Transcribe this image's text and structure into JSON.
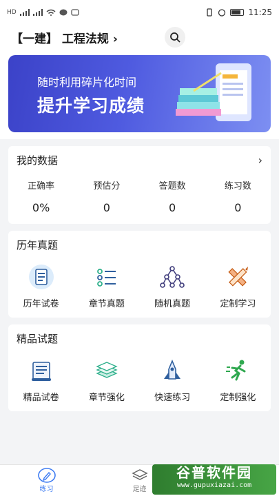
{
  "status_bar": {
    "left_label": "HD",
    "time": "11:25"
  },
  "header": {
    "title": "【一建】 工程法规",
    "chevron": "›"
  },
  "banner": {
    "line1": "随时利用碎片化时间",
    "line2": "提升学习成绩"
  },
  "my_data": {
    "title": "我的数据",
    "chevron": "›",
    "stats": [
      {
        "label": "正确率",
        "value": "0%"
      },
      {
        "label": "预估分",
        "value": "0"
      },
      {
        "label": "答题数",
        "value": "0"
      },
      {
        "label": "练习数",
        "value": "0"
      }
    ]
  },
  "past_exams": {
    "title": "历年真题",
    "items": [
      {
        "label": "历年试卷",
        "icon": "exam-paper-icon"
      },
      {
        "label": "章节真题",
        "icon": "chapter-list-icon"
      },
      {
        "label": "随机真题",
        "icon": "random-nodes-icon"
      },
      {
        "label": "定制学习",
        "icon": "pencil-ruler-icon"
      }
    ]
  },
  "premium": {
    "title": "精品试题",
    "items": [
      {
        "label": "精品试卷",
        "icon": "scroll-icon"
      },
      {
        "label": "章节强化",
        "icon": "stack-icon"
      },
      {
        "label": "快速练习",
        "icon": "rocket-icon"
      },
      {
        "label": "定制强化",
        "icon": "runner-icon"
      }
    ]
  },
  "tabbar": {
    "tabs": [
      {
        "label": "练习",
        "icon": "pencil-circle-icon"
      },
      {
        "label": "足迹",
        "icon": "layers-icon"
      }
    ]
  },
  "watermark": {
    "title": "谷普软件园",
    "url": "www.gupuxiazai.com"
  },
  "colors": {
    "accent": "#3d7bf2",
    "banner_start": "#3b42c8",
    "banner_end": "#7d8ff2"
  }
}
